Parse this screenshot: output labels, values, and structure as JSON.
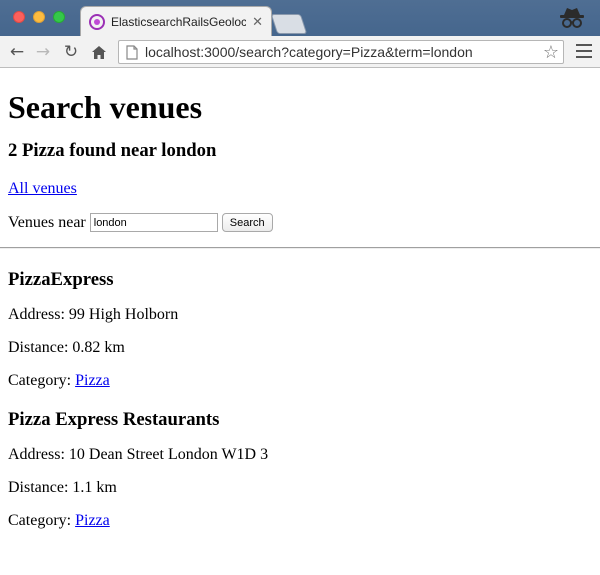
{
  "browser": {
    "tab_title": "ElasticsearchRailsGeolocation",
    "url": "localhost:3000/search?category=Pizza&term=london",
    "icons": {
      "back": "arrow-left-icon",
      "forward": "arrow-right-icon",
      "reload": "reload-icon",
      "home": "home-icon",
      "bookmark": "star-icon",
      "menu": "hamburger-menu-icon",
      "incognito": "incognito-icon"
    }
  },
  "page": {
    "title": "Search venues",
    "subtitle": "2 Pizza found near london",
    "all_venues_link": "All venues",
    "search": {
      "label": "Venues near",
      "value": "london",
      "button": "Search"
    },
    "venues": [
      {
        "name": "PizzaExpress",
        "address": "Address: 99 High Holborn",
        "distance": "Distance: 0.82 km",
        "category_label": "Category:",
        "category": "Pizza"
      },
      {
        "name": "Pizza Express Restaurants",
        "address": "Address: 10 Dean Street London W1D 3",
        "distance": "Distance: 1.1 km",
        "category_label": "Category:",
        "category": "Pizza"
      }
    ]
  }
}
